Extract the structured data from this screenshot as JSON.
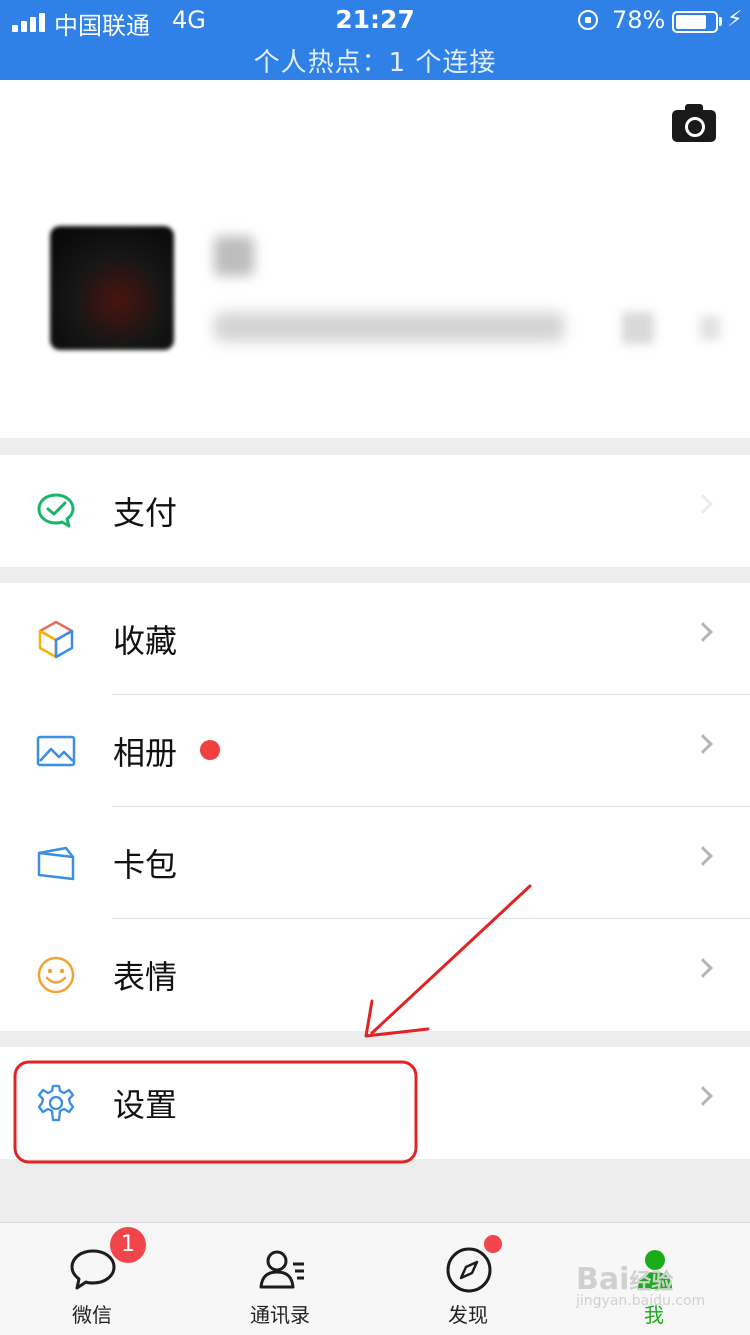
{
  "status_bar": {
    "carrier": "中国联通",
    "network": "4G",
    "time": "21:27",
    "battery": "78%",
    "battery_level": 0.78,
    "hotspot": "个人热点：1 个连接"
  },
  "profile": {
    "camera_icon": "camera-icon"
  },
  "menu": {
    "pay": "支付",
    "favorites": "收藏",
    "album": "相册",
    "cards": "卡包",
    "stickers": "表情",
    "settings": "设置"
  },
  "tabbar": {
    "tabs": [
      {
        "label": "微信",
        "badge": "1",
        "icon": "chat-icon"
      },
      {
        "label": "通讯录",
        "icon": "contacts-icon"
      },
      {
        "label": "发现",
        "icon": "compass-icon"
      },
      {
        "label": "我",
        "icon": "me-icon"
      }
    ]
  },
  "watermark": {
    "brand": "Bai",
    "brand2": "经验",
    "url": "jingyan.baidu.com"
  },
  "colors": {
    "status_bar": "#2f80e7",
    "active_tab": "#1aad19",
    "annotation": "#e02424",
    "badge": "#f0454a"
  }
}
